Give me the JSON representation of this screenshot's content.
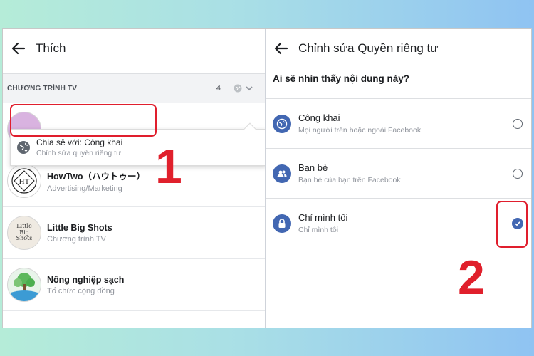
{
  "left_panel": {
    "title": "Thích",
    "section": {
      "title": "CHƯƠNG TRÌNH TV",
      "count": "4"
    },
    "dropdown": {
      "title": "Chia sẻ với: Công khai",
      "subtitle": "Chỉnh sửa quyền riêng tư"
    },
    "items": [
      {
        "title": "HowTwo（ハウトゥー）",
        "subtitle": "Advertising/Marketing",
        "avatar_text": "HT"
      },
      {
        "title": "Little Big Shots",
        "subtitle": "Chương trình TV",
        "avatar_text": "Little Big Shots"
      },
      {
        "title": "Nông nghiệp sạch",
        "subtitle": "Tổ chức cộng đồng"
      }
    ],
    "annotation": "1"
  },
  "right_panel": {
    "title": "Chỉnh sửa Quyền riêng tư",
    "question": "Ai sẽ nhìn thấy nội dung này?",
    "options": [
      {
        "title": "Công khai",
        "subtitle": "Mọi người trên hoặc ngoài Facebook",
        "icon": "globe-icon",
        "selected": false
      },
      {
        "title": "Bạn bè",
        "subtitle": "Bạn bè của bạn trên Facebook",
        "icon": "friends-icon",
        "selected": false
      },
      {
        "title": "Chỉ mình tôi",
        "subtitle": "Chỉ mình tôi",
        "icon": "lock-icon",
        "selected": true
      }
    ],
    "annotation": "2"
  },
  "colors": {
    "accent": "#4267b2",
    "highlight": "#e01e2d"
  }
}
